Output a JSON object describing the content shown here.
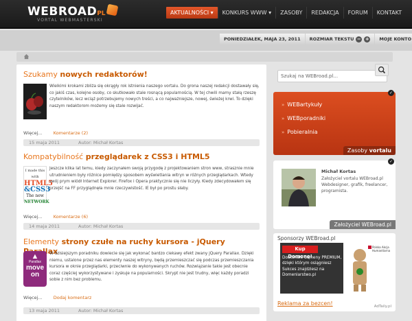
{
  "header": {
    "logo": "WEBROAD",
    "logo_suffix": "PL",
    "tagline": "VORTAL WEBMASTERSKI",
    "nav": [
      {
        "label": "AKTUALNOŚCI ▾",
        "active": true
      },
      {
        "label": "KONKURS WWW ▾",
        "active": false
      },
      {
        "label": "ZASOBY",
        "active": false
      },
      {
        "label": "REDAKCJA",
        "active": false
      },
      {
        "label": "FORUM",
        "active": false
      },
      {
        "label": "KONTAKT",
        "active": false
      }
    ]
  },
  "subbar": {
    "date": "PONIEDZIAŁEK, MAJA 23, 2011",
    "text_size": "ROZMIAR TEKSTU",
    "minus": "−",
    "plus": "+",
    "account": "MOJE KONTO"
  },
  "posts": [
    {
      "title_plain": "Szukamy ",
      "title_bold": "nowych redaktorów!",
      "body": "Wielkimi krokami zbliża się okrągły rok istnienia naszego vortalu. Do grona naszej redakcji dostawały się, co jakiś czas, kolejne osoby, co skutkowało stale rosnącą popularnością. W tej chwili mamy stałą rzeszę czytelników, lecz wciąż potrzebujemy nowych treści, a co najważniejsze, nowej, świeżej krwi. To dzięki naszym redaktorom możemy się stale rozwijać.",
      "more": "Więcej...",
      "comments": "Komentarze (2)",
      "date": "15 maja 2011",
      "author": "Autor: Michał Kortas"
    },
    {
      "title_plain": "Kompatybilność ",
      "title_bold": "przeglądarek z CSS3 i HTML5",
      "body": "Jeszcze kilka lat temu, kiedy zaczynałem swoją przygodę z projektowaniem stron www, strasznie mnie utrudnieniem były różnice pomiędzy sposobem wyświetlania witryn w różnych przeglądarkach. Wtedy swój prym wiódł Internet Explorer. Firefox i Opera praktycznie się nie liczyły. Kiedy zdecydowałem się przejść na FF przyglądnęła mnie rzeczywistość. IE był po prostu słaby.",
      "more": "Więcej...",
      "comments": "Komentarze (6)",
      "date": "14 maja 2011",
      "author": "Autor: Michał Kortas",
      "thumb_lines": [
        "I made this with",
        "HTML5",
        "&CSS3",
        "The new",
        "NETWORK"
      ]
    },
    {
      "title_plain": "Elementy ",
      "title_bold": "strony czułe na ruchy kursora - jQuery Parallax",
      "body": "W dzisiejszym poradniku dowiecie się jak wykonać bardzo ciekawy efekt zwany jQuery Parallax. Dzięki niemu, ustalone przez nas elementy naszej witryny, będą przemieszczać się podczas przemieszczania kursora w oknie przeglądarki, przeciwnie do wykonywanych ruchów. Rozwiązanie takie jest obecnie coraz częściej wykorzystywane i zyskuje na popularności. Skrypt nie jest trudny, więc każdy poradzi sobie z nim bez problemu.",
      "more": "Więcej...",
      "comments": "Dodaj komentarz",
      "date": "13 maja 2011",
      "author": "Autor: Michał Kortas",
      "thumb_lines": [
        "Parallax",
        "move",
        "on"
      ]
    }
  ],
  "sidebar": {
    "search_placeholder": "Szukaj na WEBroad.pl...",
    "links": [
      "WEBartykuły",
      "WEBporadniki",
      "Pobieralnia"
    ],
    "zasoby_prefix": "Zasoby",
    "zasoby_bold": "vortalu",
    "author_name": "Michał Kortas",
    "author_desc": "Założyciel vortalu WEBroad.pl Webdesigner, grafik, freelancer, programista.",
    "author_tab": "Założyciel WEBroad.pl",
    "sponsors_title": "Sponsorzy WEBroad.pl",
    "ad_title": "Kup Domenę!",
    "ad_text": "Doskonałe domeny PREMIUM, dzięki którym osiągniesz Sukces znajdziesz na Domenlarstwo.pl",
    "ad_badge": "Polska Akcja Humanitarna",
    "reklama": "Reklama za bezcen!",
    "adtaily": "AdTaily.pl"
  },
  "colors": {
    "accent": "#e4572a",
    "title": "#e8761d",
    "dark": "#1a1a1a"
  }
}
